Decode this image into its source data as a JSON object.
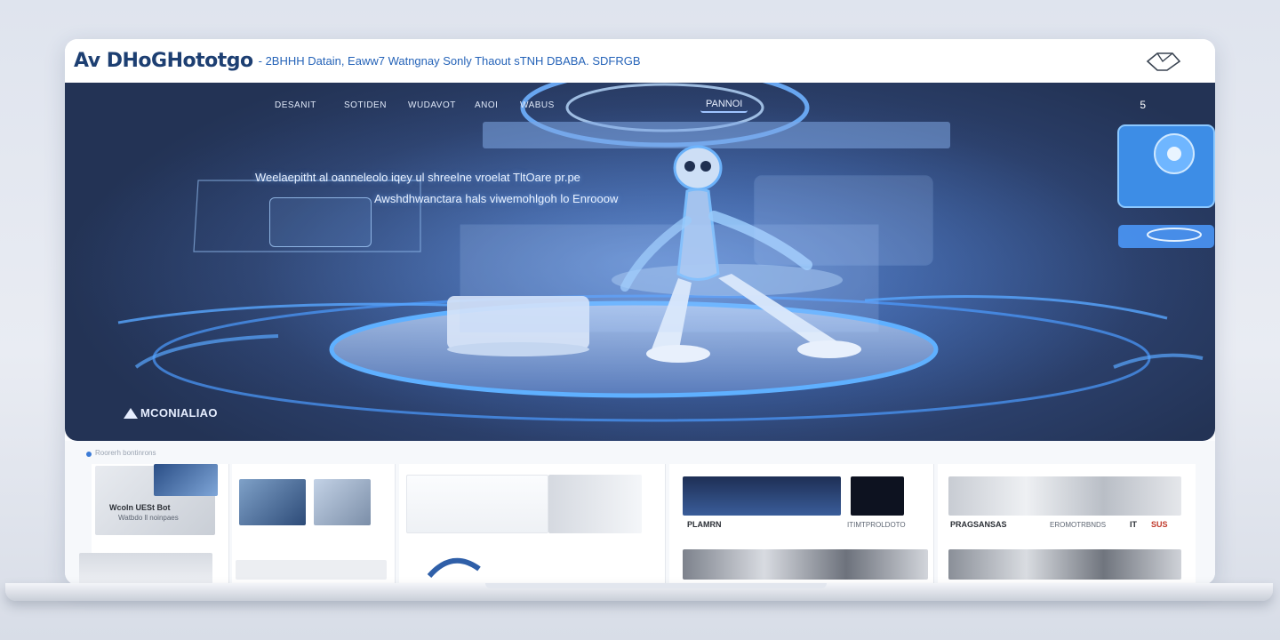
{
  "header": {
    "logo_text": "Av DHoGHototgo",
    "tagline": "- 2BHHH Datain, Eaww7 Watngnay Sonly Thaout sTNH DBABA. SDFRGB"
  },
  "hero": {
    "nav": [
      "DESANIT",
      "SOTIDEN",
      "WUDAVOT",
      "ANOI",
      "WABUS"
    ],
    "nav_cta": "PANNOI",
    "menu_marker": "5",
    "headline_line1": "Weelaepitht al oanneleolo iqey ul shreelne vroelat TltOare pr.pe",
    "headline_line2": "Awshdhwanctara hals viwemohlgoh lo Enrooow",
    "brand_label": "MCONIALIAO"
  },
  "strip": {
    "crumb": "Roorerh bontinrons",
    "cards": [
      {
        "caption": "Wcoln UESt Bot",
        "sub": "Watbdo ll noinpaes"
      },
      {
        "caption": "",
        "sub": ""
      },
      {
        "caption": "",
        "sub": ""
      },
      {
        "caption": "PLAMRN",
        "sub": "ITIMTPROLDOTO"
      },
      {
        "caption": "PRAGSANSAS",
        "sub": "EROMOTRBNDS"
      }
    ],
    "badge": "SUS",
    "card4_letter": "IT"
  },
  "colors": {
    "accent": "#2b76c8",
    "hero_dark": "#233355",
    "hero_glow": "#4c9bff"
  }
}
